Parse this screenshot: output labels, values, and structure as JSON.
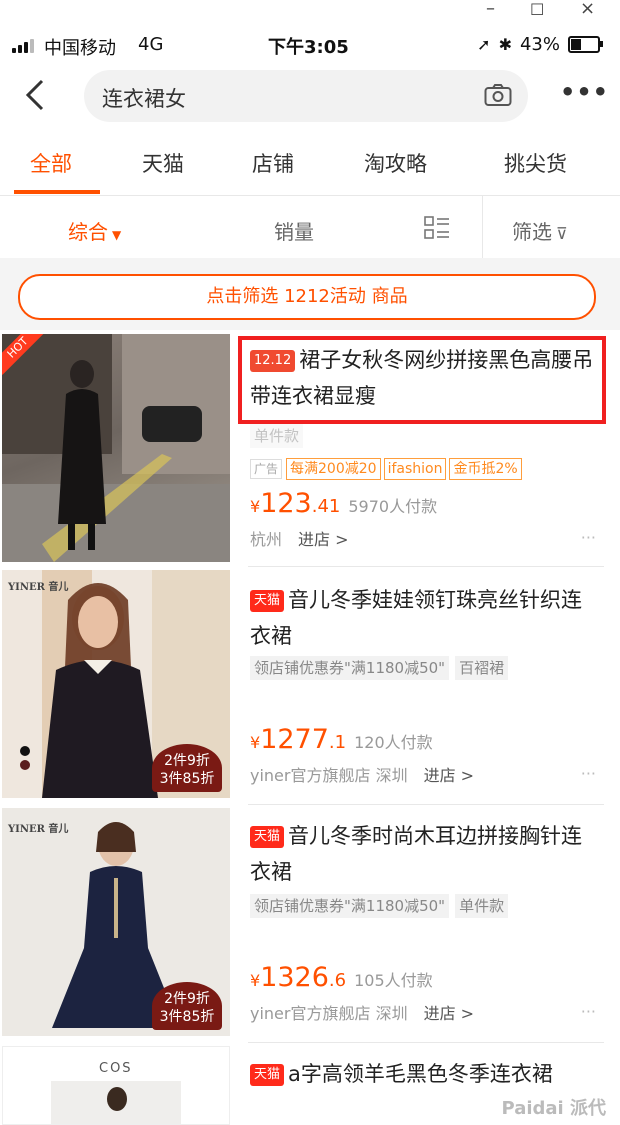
{
  "window": {
    "minimize": "–",
    "maximize": "☐",
    "close": "×"
  },
  "status_bar": {
    "carrier": "中国移动",
    "network": "4G",
    "time": "下午3:05",
    "battery": "43%",
    "battery_level": 0.43
  },
  "search": {
    "query": "连衣裙女"
  },
  "tabs": [
    {
      "label": "全部",
      "active": true
    },
    {
      "label": "天猫"
    },
    {
      "label": "店铺"
    },
    {
      "label": "淘攻略"
    },
    {
      "label": "挑尖货"
    }
  ],
  "sort": {
    "comprehensive": "综合",
    "sales": "销量",
    "filter": "筛选"
  },
  "promo_banner": "点击筛选 1212活动 商品",
  "products": [
    {
      "badge": "HOT",
      "title_tag": "12.12",
      "title": "裙子女秋冬网纱拼接黑色高腰吊带连衣裙显瘦",
      "hidden_chip": "单件款",
      "ad_label": "广告",
      "coupons": [
        "每满200减20",
        "ifashion",
        "金币抵2%"
      ],
      "price_int": "123",
      "price_dec": ".41",
      "currency": "¥",
      "buyers": "5970人付款",
      "location": "杭州",
      "enter_store": "进店 >",
      "more": "···"
    },
    {
      "brand": "YINER 音儿",
      "title_tag": "天猫",
      "title": "音儿冬季娃娃领钉珠亮丝针织连衣裙",
      "chips": [
        "领店铺优惠券\"满1180减50\"",
        "百褶裙"
      ],
      "promo_badge": [
        "2件9折",
        "3件85折"
      ],
      "price_int": "1277",
      "price_dec": ".1",
      "currency": "¥",
      "buyers": "120人付款",
      "shop": "yiner官方旗舰店",
      "location": "深圳",
      "enter_store": "进店 >",
      "more": "···"
    },
    {
      "brand": "YINER 音儿",
      "title_tag": "天猫",
      "title": "音儿冬季时尚木耳边拼接胸针连衣裙",
      "chips": [
        "领店铺优惠券\"满1180减50\"",
        "单件款"
      ],
      "promo_badge": [
        "2件9折",
        "3件85折"
      ],
      "price_int": "1326",
      "price_dec": ".6",
      "currency": "¥",
      "buyers": "105人付款",
      "shop": "yiner官方旗舰店",
      "location": "深圳",
      "enter_store": "进店 >",
      "more": "···"
    },
    {
      "brand": "COS",
      "title_tag": "天猫",
      "title": "a字高领羊毛黑色冬季连衣裙"
    }
  ],
  "watermark": "Paidai 派代",
  "colors": {
    "accent": "#ff5000",
    "tmall_red": "#ff2a1a",
    "highlight": "#f02020"
  }
}
